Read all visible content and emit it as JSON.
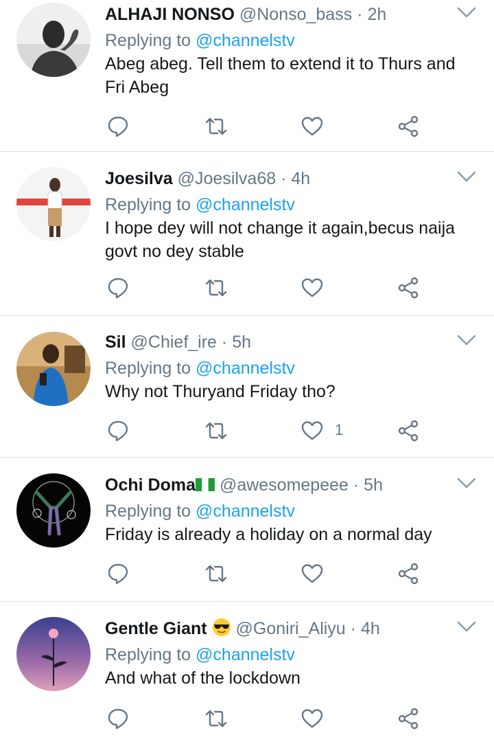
{
  "tweets": [
    {
      "name": "ALHAJI NONSO",
      "handle": "@Nonso_bass",
      "separator": "·",
      "time": "2h",
      "replying_prefix": "Replying to ",
      "replying_to": "@channelstv",
      "text": "Abeg abeg.  Tell them to extend it to Thurs and Fri Abeg",
      "like_count": ""
    },
    {
      "name": "Joesilva",
      "handle": "@Joesilva68",
      "separator": "·",
      "time": "4h",
      "replying_prefix": "Replying to ",
      "replying_to": "@channelstv",
      "text": "I hope dey will not change it again,becus naija govt no dey stable",
      "like_count": ""
    },
    {
      "name": "Sil",
      "handle": "@Chief_ire",
      "separator": "·",
      "time": "5h",
      "replying_prefix": "Replying to ",
      "replying_to": "@channelstv",
      "text": "Why not Thuryand Friday tho?",
      "like_count": "1"
    },
    {
      "name": "Ochi Doma",
      "handle": "@awesomepeee",
      "separator": "·",
      "time": "5h",
      "replying_prefix": "Replying to ",
      "replying_to": "@channelstv",
      "text": "Friday is already a holiday on a normal day",
      "like_count": ""
    },
    {
      "name": "Gentle Giant",
      "handle": "@Goniri_Aliyu",
      "separator": "·",
      "time": "4h",
      "replying_prefix": "Replying to ",
      "replying_to": "@channelstv",
      "text": "And what of the lockdown",
      "like_count": ""
    }
  ],
  "icons": {
    "reply": "reply-icon",
    "retweet": "retweet-icon",
    "like": "heart-icon",
    "share": "share-icon",
    "menu": "chevron-down-icon",
    "flag": "nigeria-flag-icon",
    "emoji": "sunglasses-emoji-icon"
  },
  "colors": {
    "text": "#14171a",
    "muted": "#657786",
    "link": "#1da1f2",
    "divider": "#dfe3e6"
  }
}
